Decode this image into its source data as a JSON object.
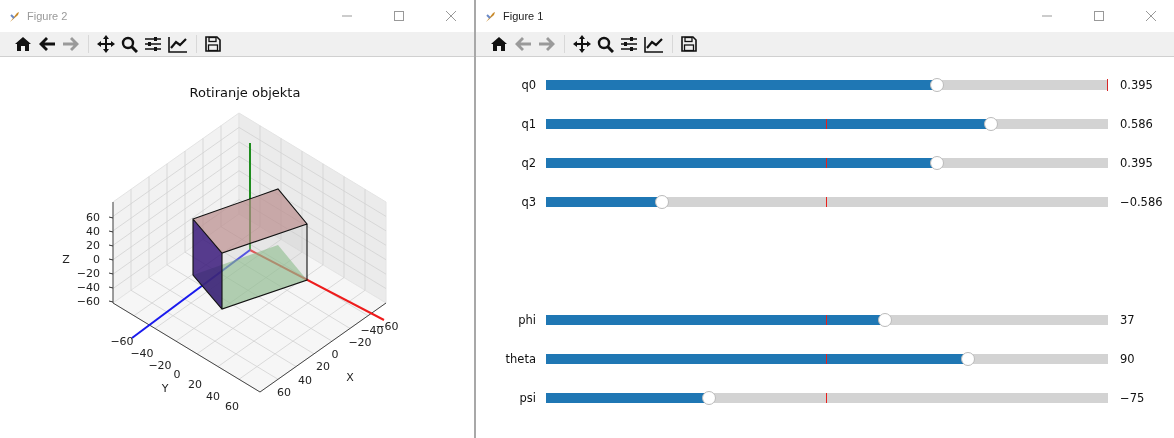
{
  "windows": [
    {
      "title": "Figure 2",
      "active": false,
      "toolbar": [
        {
          "kind": "home",
          "disabled": false
        },
        {
          "kind": "back",
          "disabled": false
        },
        {
          "kind": "forward",
          "disabled": true
        },
        {
          "kind": "pan",
          "disabled": false
        },
        {
          "kind": "zoom",
          "disabled": false
        },
        {
          "kind": "configure",
          "disabled": false
        },
        {
          "kind": "edit",
          "disabled": false
        },
        {
          "kind": "save",
          "disabled": false
        }
      ],
      "content": {
        "kind": "plot3d",
        "title": "Rotiranje objekta",
        "z_label": "Z",
        "y_label": "Y",
        "x_label": "X",
        "z_ticks": [
          "60",
          "40",
          "20",
          "0",
          "−20",
          "−40",
          "−60"
        ],
        "y_ticks": [
          "−60",
          "−40",
          "−20",
          "0",
          "20",
          "40",
          "60"
        ],
        "x_ticks": [
          "−60",
          "−40",
          "−20",
          "0",
          "20",
          "40",
          "60"
        ]
      }
    },
    {
      "title": "Figure 1",
      "active": true,
      "toolbar": [
        {
          "kind": "home",
          "disabled": false
        },
        {
          "kind": "back",
          "disabled": true
        },
        {
          "kind": "forward",
          "disabled": true
        },
        {
          "kind": "pan",
          "disabled": false
        },
        {
          "kind": "zoom",
          "disabled": false
        },
        {
          "kind": "configure",
          "disabled": false
        },
        {
          "kind": "edit",
          "disabled": false
        },
        {
          "kind": "save",
          "disabled": false
        }
      ],
      "content": {
        "kind": "sliders",
        "groups": [
          [
            {
              "label": "q0",
              "level": 0.696,
              "value": "0.395",
              "marker_at_end": true
            },
            {
              "label": "q1",
              "level": 0.792,
              "value": "0.586",
              "marker_at_end": false
            },
            {
              "label": "q2",
              "level": 0.696,
              "value": "0.395",
              "marker_at_end": false
            },
            {
              "label": "q3",
              "level": 0.206,
              "value": "−0.586",
              "marker_at_end": false
            }
          ],
          [
            {
              "label": "phi",
              "level": 0.603,
              "value": "37",
              "marker_at_end": false
            },
            {
              "label": "theta",
              "level": 0.751,
              "value": "90",
              "marker_at_end": false
            },
            {
              "label": "psi",
              "level": 0.29,
              "value": "−75",
              "marker_at_end": false
            }
          ]
        ]
      }
    }
  ]
}
